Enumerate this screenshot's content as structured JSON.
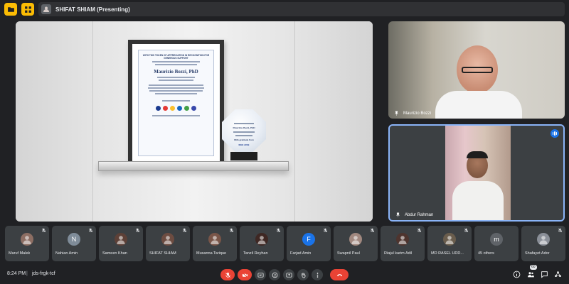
{
  "topbar": {
    "presenting": "SHIFAT SHIAM (Presenting)"
  },
  "shared_screen": {
    "cert_heading": "WITH THIS TOKEN OF APPRECIATION IN RECOGNITION FOR GENEROUS SUPPORT",
    "cert_name": "Maurizio Bozzi, PhD",
    "trophy_name": "Maurizio Bozzi, PhD",
    "trophy_footer": "With gratitude from",
    "trophy_org": "IEEE AIUB"
  },
  "tiles": [
    {
      "name": "Maurizio Bozzi"
    },
    {
      "name": "Abdur Rahman"
    }
  ],
  "participants": [
    {
      "name": "Maruf Malek",
      "avatar": "photo",
      "color": "#8d6e63"
    },
    {
      "name": "Nahian Amin",
      "avatar": "N",
      "color": "#7f8c99"
    },
    {
      "name": "Sameen Khan",
      "avatar": "photo",
      "color": "#5d4037"
    },
    {
      "name": "SHIFAT SHIAM",
      "avatar": "photo",
      "color": "#6d4c41"
    },
    {
      "name": "Musanna Tarique",
      "avatar": "photo",
      "color": "#795548"
    },
    {
      "name": "Tanzil Reyhan",
      "avatar": "photo",
      "color": "#3e2723"
    },
    {
      "name": "Farjad Amin",
      "avatar": "F",
      "color": "#1a73e8"
    },
    {
      "name": "Swapnil Paul",
      "avatar": "photo",
      "color": "#a1887f"
    },
    {
      "name": "Riajul karim Adil",
      "avatar": "photo",
      "color": "#4e342e"
    },
    {
      "name": "MD RASEL UDD...",
      "avatar": "photo",
      "color": "#6a5d4d"
    },
    {
      "name": "45 others",
      "avatar": "m",
      "color": "#5f6368"
    },
    {
      "name": "Shafayet Ador",
      "avatar": "photo",
      "color": "#8a8f98"
    }
  ],
  "bottombar": {
    "time": "8:24 PM",
    "separator": "|",
    "meeting_code": "jds-frgk-tcf",
    "participant_count": "60"
  },
  "colors": {
    "background": "#202124",
    "accent": "#8ab4f8",
    "danger": "#ea4335",
    "tile": "#3c4043"
  }
}
